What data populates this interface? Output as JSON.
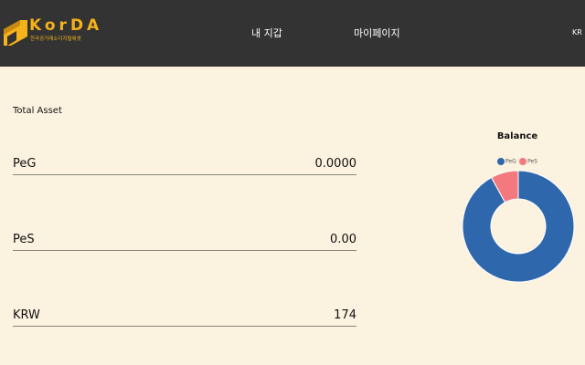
{
  "header": {
    "logo_text": "KorDA",
    "logo_subtitle": "한국공거래소디지털애셋",
    "nav": {
      "wallet": "내 지갑",
      "mypage": "마이페이지",
      "language": "KR"
    },
    "colors": {
      "bar": "#333333",
      "brand": "#f5b21a"
    }
  },
  "main": {
    "section_title": "Total Asset",
    "assets": [
      {
        "name": "PeG",
        "value": "0.0000"
      },
      {
        "name": "PeS",
        "value": "0.00"
      },
      {
        "name": "KRW",
        "value": "174"
      }
    ]
  },
  "chart_data": {
    "type": "pie",
    "title": "Balance",
    "legend_position": "top",
    "series": [
      {
        "name": "PeG",
        "value": 92,
        "color": "#2f67ad"
      },
      {
        "name": "PeS",
        "value": 8,
        "color": "#f4797e"
      }
    ]
  }
}
